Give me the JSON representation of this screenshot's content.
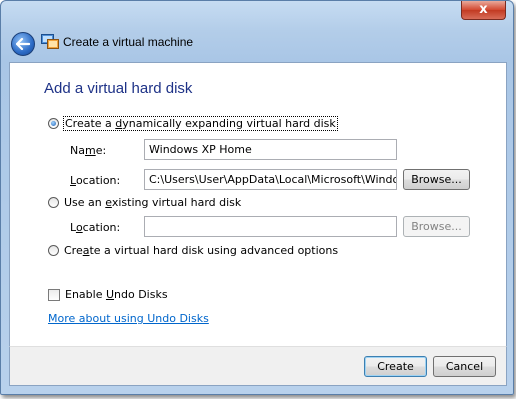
{
  "window": {
    "title": "Create a virtual machine",
    "close_glyph": "x",
    "back_icon": "back-arrow-icon",
    "app_icon": "virtual-pc-icon"
  },
  "page": {
    "heading": "Add a virtual hard disk"
  },
  "options": {
    "dynamic": {
      "label_pre": "Create a ",
      "label_key": "d",
      "label_post": "ynamically expanding virtual hard disk",
      "checked": true
    },
    "name": {
      "label_pre": "Na",
      "label_key": "m",
      "label_post": "e:",
      "value": "Windows XP Home"
    },
    "location1": {
      "label_pre": "",
      "label_key": "L",
      "label_post": "ocation:",
      "value": "C:\\Users\\User\\AppData\\Local\\Microsoft\\Windows Virtual PC\\Virtual Machines",
      "browse_label": "Browse..."
    },
    "existing": {
      "label_pre": "Use an ",
      "label_key": "e",
      "label_post": "xisting virtual hard disk",
      "checked": false
    },
    "location2": {
      "label_pre": "L",
      "label_key": "o",
      "label_post": "cation:",
      "value": "",
      "browse_label": "Browse..."
    },
    "advanced": {
      "label_pre": "Cre",
      "label_key": "a",
      "label_post": "te a virtual hard disk using advanced options",
      "checked": false
    },
    "undo": {
      "label_pre": "Enable ",
      "label_key": "U",
      "label_post": "ndo Disks",
      "checked": false
    }
  },
  "link": {
    "undo_help": "More about using Undo Disks"
  },
  "footer": {
    "create_label": "Create",
    "cancel_label": "Cancel"
  }
}
